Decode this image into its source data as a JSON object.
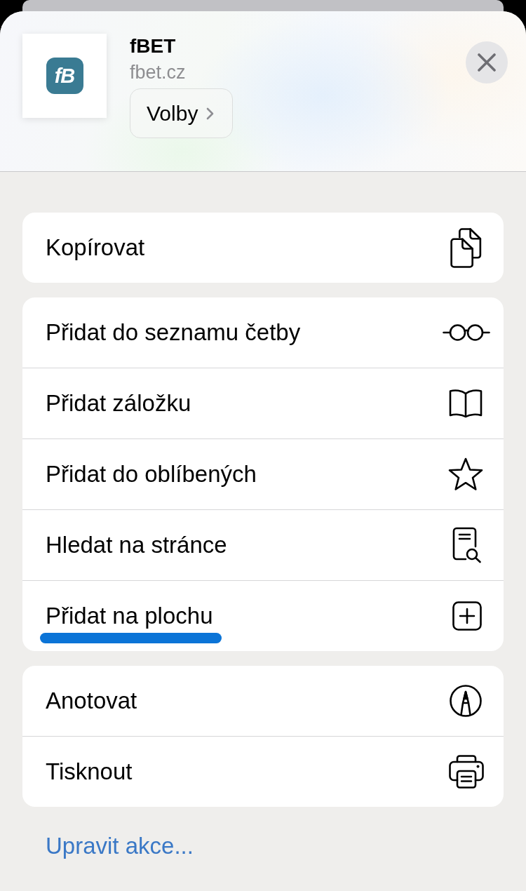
{
  "header": {
    "logo_text": "fB",
    "title": "fBET",
    "subtitle": "fbet.cz",
    "options_button": "Volby"
  },
  "groups": [
    {
      "items": [
        {
          "kind": "copy",
          "label": "Kopírovat",
          "underlined": false
        }
      ]
    },
    {
      "items": [
        {
          "kind": "reading-list",
          "label": "Přidat do seznamu četby",
          "underlined": false
        },
        {
          "kind": "bookmark",
          "label": "Přidat záložku",
          "underlined": false
        },
        {
          "kind": "favorite",
          "label": "Přidat do oblíbených",
          "underlined": false
        },
        {
          "kind": "find",
          "label": "Hledat na stránce",
          "underlined": false
        },
        {
          "kind": "home-screen",
          "label": "Přidat na plochu",
          "underlined": true
        }
      ]
    },
    {
      "items": [
        {
          "kind": "markup",
          "label": "Anotovat",
          "underlined": false
        },
        {
          "kind": "print",
          "label": "Tisknout",
          "underlined": false
        }
      ]
    }
  ],
  "edit_link": "Upravit akce..."
}
